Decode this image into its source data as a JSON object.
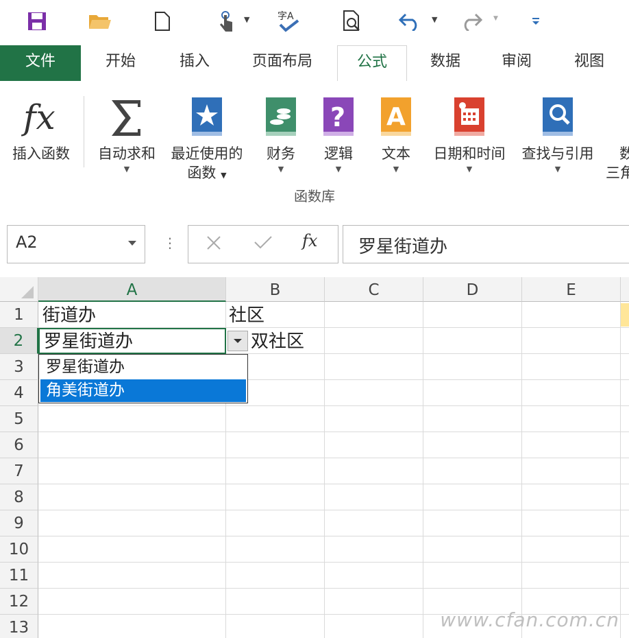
{
  "tabs": [
    {
      "label": "文件"
    },
    {
      "label": "开始"
    },
    {
      "label": "插入"
    },
    {
      "label": "页面布局"
    },
    {
      "label": "公式"
    },
    {
      "label": "数据"
    },
    {
      "label": "审阅"
    },
    {
      "label": "视图"
    }
  ],
  "ribbon": {
    "insert_function": "插入函数",
    "autosum": "自动求和",
    "recent_line1": "最近使用的",
    "recent_line2": "函数",
    "financial": "财务",
    "logical": "逻辑",
    "text": "文本",
    "datetime": "日期和时间",
    "lookup": "查找与引用",
    "math_partial": "数",
    "math_partial2": "三角",
    "group_label": "函数库"
  },
  "formula_bar": {
    "name_box": "A2",
    "formula": "罗星街道办",
    "fx_label": "fx"
  },
  "columns": [
    "A",
    "B",
    "C",
    "D",
    "E"
  ],
  "rows": [
    "1",
    "2",
    "3",
    "4",
    "5",
    "6",
    "7",
    "8",
    "9",
    "10",
    "11",
    "12",
    "13"
  ],
  "cells": {
    "A1": "街道办",
    "B1": "社区",
    "A2": "罗星街道办",
    "B2": "双社区"
  },
  "dropdown_options": [
    "罗星街道办",
    "角美街道办"
  ],
  "watermark": "www.cfan.com.cn",
  "colors": {
    "accent": "#217346",
    "highlight": "#0a78d7"
  }
}
